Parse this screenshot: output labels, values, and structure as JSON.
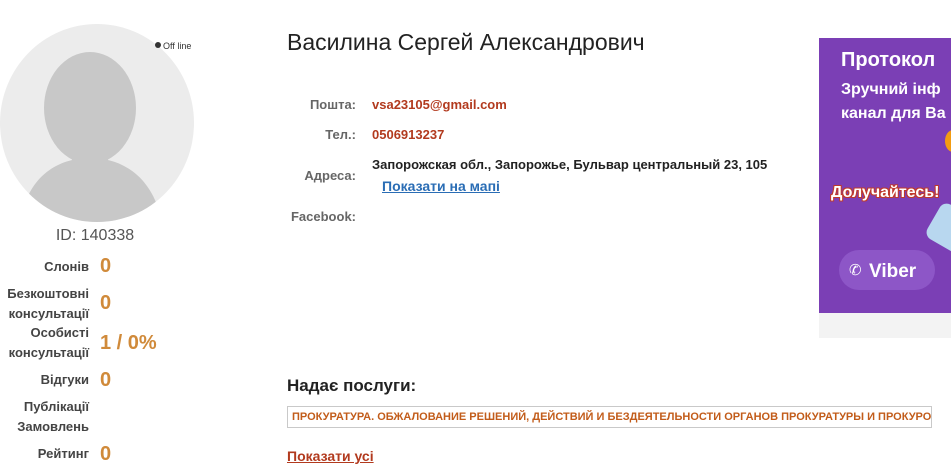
{
  "profile": {
    "status": "Off line",
    "id_label": "ID: 140338",
    "name": "Василина Сергей Александрович"
  },
  "stats": [
    {
      "label_lines": [
        "Слонів"
      ],
      "value": "0"
    },
    {
      "label_lines": [
        "Безкоштовні",
        "консультації"
      ],
      "value": "0"
    },
    {
      "label_lines": [
        "Особисті",
        "консультації"
      ],
      "value": "1 / 0%"
    },
    {
      "label_lines": [
        "Відгуки"
      ],
      "value": "0"
    },
    {
      "label_lines": [
        "Публікації",
        "Замовлень"
      ],
      "value": ""
    },
    {
      "label_lines": [
        "Рейтинг"
      ],
      "value": "0"
    }
  ],
  "contacts": {
    "email_label": "Пошта:",
    "email": "vsa23105@gmail.com",
    "phone_label": "Тел.:",
    "phone": "0506913237",
    "address_label": "Адреса:",
    "address": "Запорожская обл., Запорожье, Бульвар центральный 23, 105",
    "map_link": "Показати на мапі",
    "facebook_label": "Facebook:"
  },
  "services": {
    "title": "Надає послуги:",
    "items": [
      "ПРОКУРАТУРА. ОБЖАЛОВАНИЕ РЕШЕНИЙ, ДЕЙСТВИЙ И БЕЗДЕЯТЕЛЬНОСТИ ОРГАНОВ ПРОКУРАТУРЫ И ПРОКУРОРОВ."
    ],
    "show_all": "Показати усі"
  },
  "ad": {
    "title": "Протокол",
    "line1": "Зручний інф",
    "line2": "канал для Ва",
    "cta": "Долучайтесь!",
    "brand": "Viber",
    "background": "#7b3fb5"
  },
  "colors": {
    "accent_red": "#b23a1e",
    "stat_orange": "#d08a3a",
    "link_blue": "#2a6db5"
  }
}
